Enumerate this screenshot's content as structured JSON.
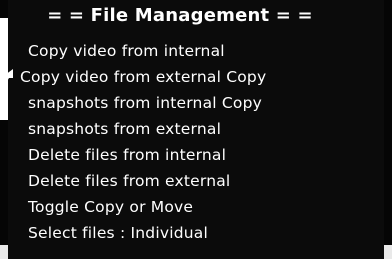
{
  "menu": {
    "title": "= = File Management = =",
    "items": [
      {
        "label": "Copy video from internal"
      },
      {
        "label": "Copy video from external Copy"
      },
      {
        "label": "snapshots from internal Copy"
      },
      {
        "label": "snapshots from external"
      },
      {
        "label": "Delete files from internal"
      },
      {
        "label": "Delete files from external"
      },
      {
        "label": "Toggle Copy or Move"
      },
      {
        "label": "Select files : Individual"
      }
    ],
    "selected_index": 1
  },
  "colors": {
    "background": "#050505",
    "text": "#ffffff",
    "bottom_bar": "#e9e9e9"
  },
  "icons": {
    "selection_pointer": "arrow-pointer-icon"
  }
}
